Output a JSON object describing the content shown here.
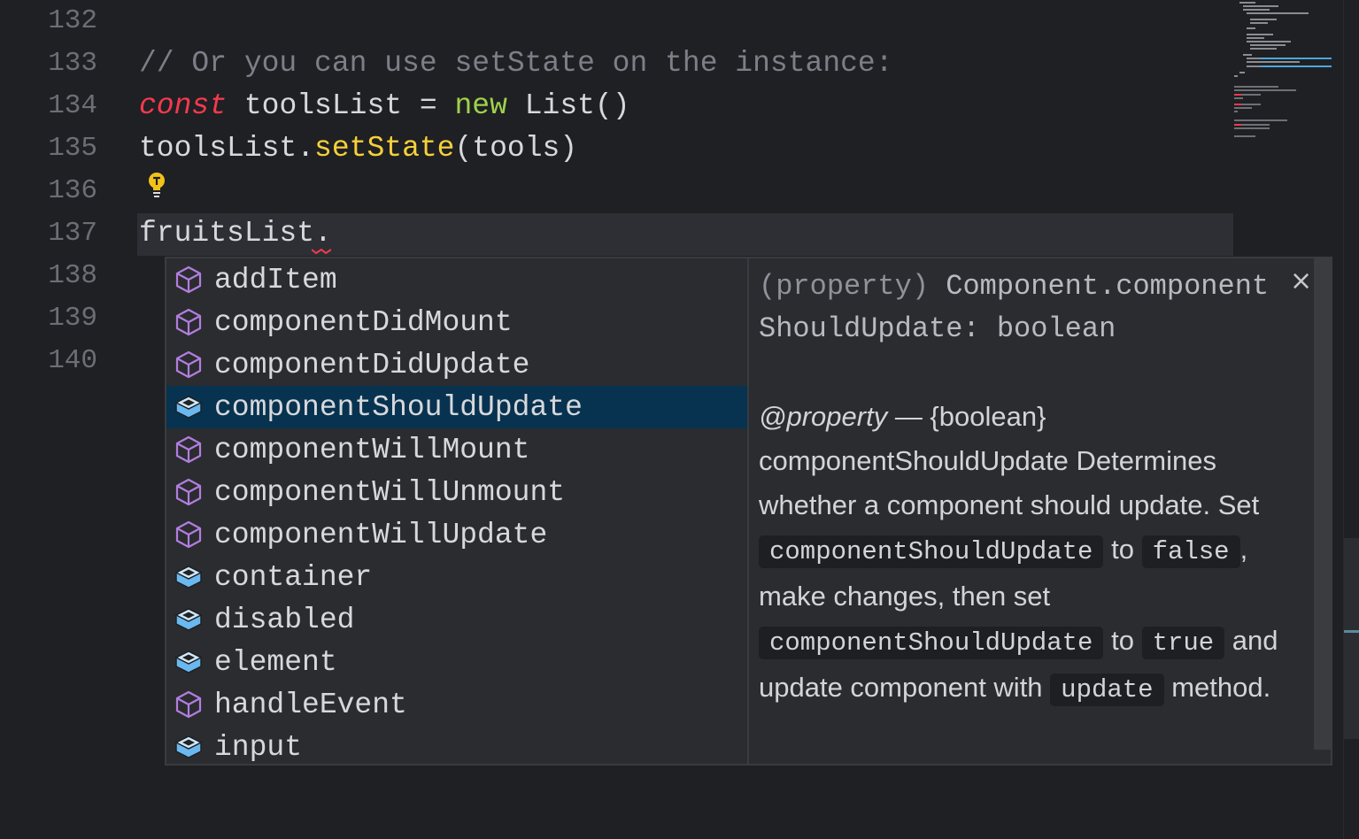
{
  "editor": {
    "line_numbers": [
      "132",
      "133",
      "134",
      "135",
      "136",
      "137",
      "138",
      "139",
      "140"
    ],
    "lines": {
      "l133_comment": "// Or you can use setState on the instance:",
      "l134_const": "const",
      "l134_name": " toolsList = ",
      "l134_new": "new",
      "l134_rest": " List()",
      "l135_obj": "toolsList.",
      "l135_fn": "setState",
      "l135_rest": "(tools)",
      "l137": "fruitsList."
    },
    "colors": {
      "keyword": "#f5394f",
      "new": "#9fd24a",
      "function": "#f5d03a",
      "selection": "#073350"
    }
  },
  "suggest": {
    "items": [
      {
        "label": "addItem",
        "icon": "method-cube-icon"
      },
      {
        "label": "componentDidMount",
        "icon": "method-cube-icon"
      },
      {
        "label": "componentDidUpdate",
        "icon": "method-cube-icon"
      },
      {
        "label": "componentShouldUpdate",
        "icon": "property-cube-icon"
      },
      {
        "label": "componentWillMount",
        "icon": "method-cube-icon"
      },
      {
        "label": "componentWillUnmount",
        "icon": "method-cube-icon"
      },
      {
        "label": "componentWillUpdate",
        "icon": "method-cube-icon"
      },
      {
        "label": "container",
        "icon": "property-cube-icon"
      },
      {
        "label": "disabled",
        "icon": "property-cube-icon"
      },
      {
        "label": "element",
        "icon": "property-cube-icon"
      },
      {
        "label": "handleEvent",
        "icon": "method-cube-icon"
      },
      {
        "label": "input",
        "icon": "property-cube-icon"
      }
    ],
    "selected_index": 3
  },
  "doc": {
    "kind": "(property)",
    "signature": "Component.componentShouldUpdate: boolean",
    "close": "×",
    "tag": "@property",
    "dash": " — {boolean}",
    "t1": "componentShouldUpdate Determines whether a component should update. Set ",
    "c1": "componentShouldUpdate",
    "to": " to ",
    "c2": "false",
    "t2": ", make changes, then set ",
    "c3": "componentShouldUpdate",
    "c4": "true",
    "t3": " and update component with ",
    "c5": "update",
    "t4": " method."
  }
}
